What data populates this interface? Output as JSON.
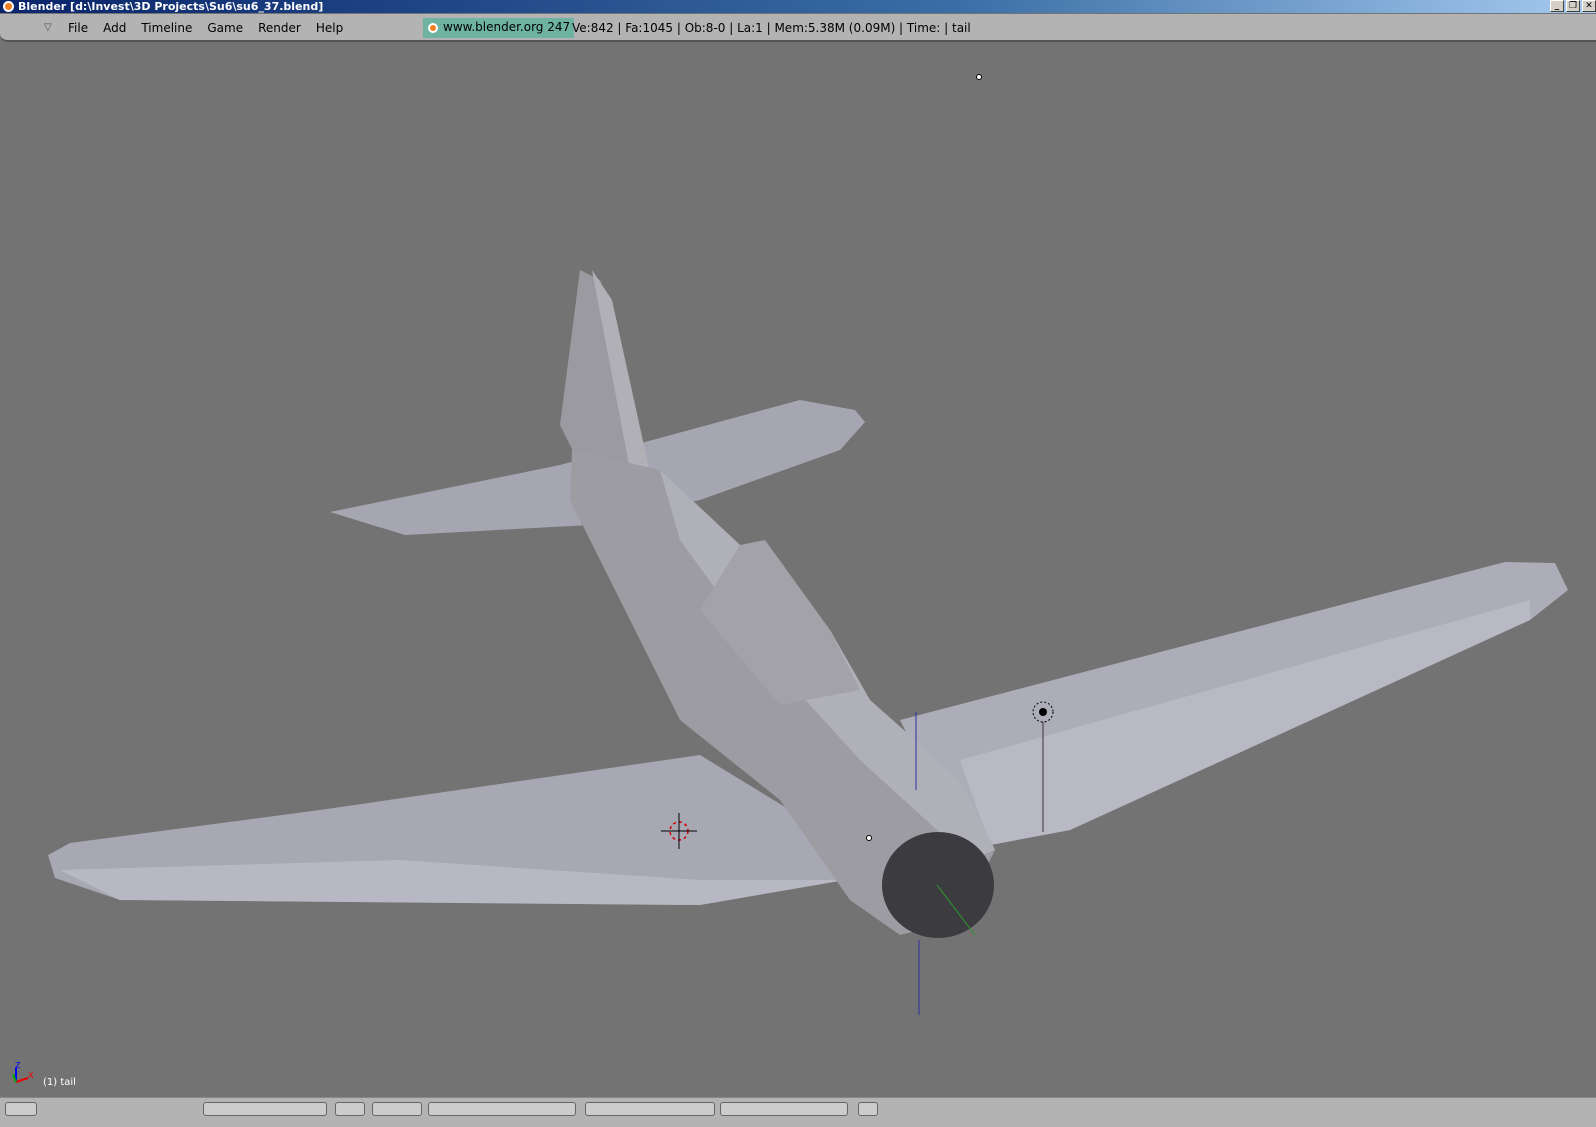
{
  "window": {
    "title": "Blender [d:\\Invest\\3D Projects\\Su6\\su6_37.blend]",
    "buttons": [
      "_",
      "❐",
      "✕"
    ]
  },
  "menubar": {
    "items": [
      "File",
      "Add",
      "Timeline",
      "Game",
      "Render",
      "Help"
    ],
    "badge": "www.blender.org 247",
    "status": "Ve:842 | Fa:1045 | Ob:8-0 | La:1  | Mem:5.38M (0.09M)  | Time: | tail"
  },
  "viewport": {
    "object_label": "(1) tail",
    "axis_x": "X",
    "axis_z": "Z"
  },
  "colors": {
    "background": "#737373",
    "mesh": "#a9a9b4",
    "menubar": "#b3b3b3",
    "badge": "#6db3a0"
  }
}
